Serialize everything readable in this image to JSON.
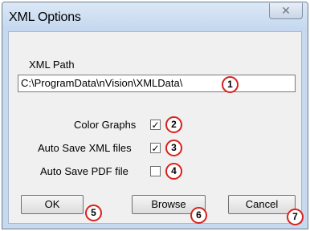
{
  "window": {
    "title": "XML Options",
    "close_glyph": "✕"
  },
  "xml_path": {
    "label": "XML Path",
    "value": "C:\\ProgramData\\nVision\\XMLData\\"
  },
  "options": [
    {
      "label": "Color Graphs",
      "checked": true
    },
    {
      "label": "Auto Save XML files",
      "checked": true
    },
    {
      "label": "Auto Save PDF file",
      "checked": false
    }
  ],
  "buttons": {
    "ok": "OK",
    "browse": "Browse",
    "cancel": "Cancel"
  },
  "callouts": [
    "1",
    "2",
    "3",
    "4",
    "5",
    "6",
    "7"
  ],
  "colors": {
    "callout_ring": "#d8201c",
    "dialog_bg": "#f0f0f0",
    "frame": "#c7d9ee"
  }
}
